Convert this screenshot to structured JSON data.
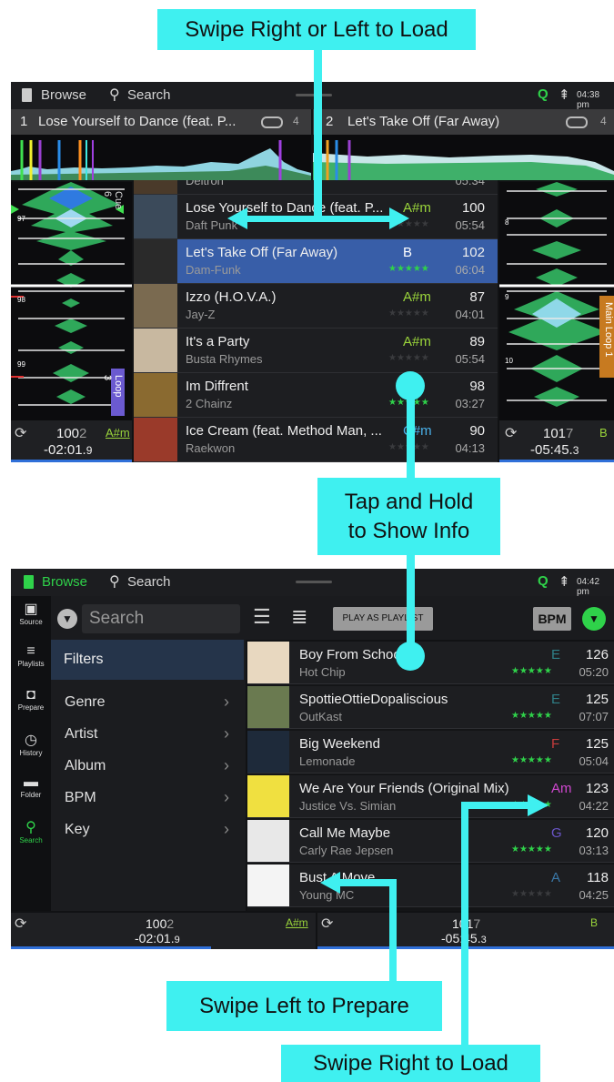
{
  "callouts": {
    "swipe_load": "Swipe Right or Left to Load",
    "tap_hold": "Tap and Hold\nto Show Info",
    "swipe_prepare": "Swipe Left to Prepare",
    "swipe_right_load": "Swipe Right to Load"
  },
  "screen1": {
    "browse": "Browse",
    "search": "Search",
    "time": "04:38 pm",
    "deck1": {
      "num": "1",
      "title": "Lose Yourself to Dance (feat. P...",
      "loop": "4"
    },
    "deck2": {
      "num": "2",
      "title": "Let's Take Off (Far Away)",
      "loop": "4"
    },
    "left_labels": {
      "cue": "Cue 6",
      "loop": "Loop 3",
      "n97": "97",
      "n98": "98",
      "n99": "99"
    },
    "right_labels": {
      "main_loop": "Main Loop 1",
      "n8": "8",
      "n9": "9",
      "n10": "10"
    },
    "partial_top": {
      "title": "Deltron",
      "dur": "05:34"
    },
    "tracks": [
      {
        "title": "Lose Yourself to Dance (feat. P...",
        "artist": "Daft Punk",
        "key": "A#m",
        "bpm": "100",
        "dur": "05:54",
        "stars": "★★★★★"
      },
      {
        "title": "Let's Take Off (Far Away)",
        "artist": "Dam-Funk",
        "key": "B",
        "bpm": "102",
        "dur": "06:04",
        "stars": "★★★★★"
      },
      {
        "title": "Izzo (H.O.V.A.)",
        "artist": "Jay-Z",
        "key": "A#m",
        "bpm": "87",
        "dur": "04:01",
        "stars": "★★★★★"
      },
      {
        "title": "It's a Party",
        "artist": "Busta Rhymes",
        "key": "A#m",
        "bpm": "89",
        "dur": "05:54",
        "stars": "★★★★★"
      },
      {
        "title": "Im Diffrent",
        "artist": "2 Chainz",
        "key": "m",
        "bpm": "98",
        "dur": "03:27",
        "stars": "★★★★★"
      },
      {
        "title": "Ice Cream (feat. Method Man, ...",
        "artist": "Raekwon",
        "key": "C#m",
        "bpm": "90",
        "dur": "04:13",
        "stars": "★★★★★"
      }
    ],
    "bottom_left": {
      "bpm_main": "100",
      "bpm_dec": "2",
      "key": "A#m",
      "time_main": "-02:01.",
      "time_dec": "9"
    },
    "bottom_right": {
      "bpm_main": "101",
      "bpm_dec": "7",
      "key": "B",
      "time_main": "-05:45.",
      "time_dec": "3"
    }
  },
  "screen2": {
    "browse": "Browse",
    "search": "Search",
    "time": "04:42 pm",
    "search_placeholder": "Search",
    "play_as_playlist": "PLAY AS PLAYLIST",
    "bpm_btn": "BPM",
    "sidebar": [
      "Source",
      "Playlists",
      "Prepare",
      "History",
      "Folder",
      "Search"
    ],
    "filters_title": "Filters",
    "filters": [
      "Genre",
      "Artist",
      "Album",
      "BPM",
      "Key"
    ],
    "tracks": [
      {
        "title": "Boy From School",
        "artist": "Hot Chip",
        "key": "E",
        "key_color": "#2f7f88",
        "bpm": "126",
        "dur": "05:20",
        "stars": "★★★★★"
      },
      {
        "title": "SpottieOttieDopaliscious",
        "artist": "OutKast",
        "key": "E",
        "key_color": "#2f7f88",
        "bpm": "125",
        "dur": "07:07",
        "stars": "★★★★★"
      },
      {
        "title": "Big Weekend",
        "artist": "Lemonade",
        "key": "F",
        "key_color": "#c83c3c",
        "bpm": "125",
        "dur": "05:04",
        "stars": "★★★★★"
      },
      {
        "title": "We Are Your Friends (Original Mix)",
        "artist": "Justice Vs. Simian",
        "key": "Am",
        "key_color": "#d048d0",
        "bpm": "123",
        "dur": "04:22",
        "stars": "★★★★★"
      },
      {
        "title": "Call Me Maybe",
        "artist": "Carly Rae Jepsen",
        "key": "G",
        "key_color": "#6a55c8",
        "bpm": "120",
        "dur": "03:13",
        "stars": "★★★★★"
      },
      {
        "title": "Bust A Move",
        "artist": "Young MC",
        "key": "A",
        "key_color": "#3a78a8",
        "bpm": "118",
        "dur": "04:25",
        "stars": "★★★★★"
      }
    ],
    "bottom_left": {
      "bpm_main": "100",
      "bpm_dec": "2",
      "key": "A#m",
      "time_main": "-02:01.",
      "time_dec": "9"
    },
    "bottom_right": {
      "bpm_main": "101",
      "bpm_dec": "7",
      "key": "B",
      "time_main": "-05:45.",
      "time_dec": "3"
    }
  },
  "colors": {
    "accent_green": "#2fd24a",
    "cyan": "#3ff0f0",
    "select_blue": "#385ea8",
    "key_green": "#9ad53b"
  }
}
